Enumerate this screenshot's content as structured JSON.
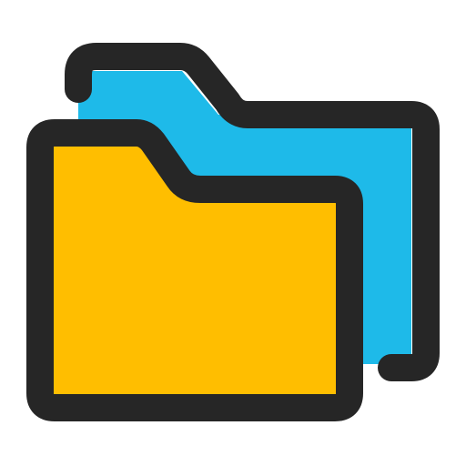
{
  "icon": {
    "name": "folders-icon",
    "colors": {
      "outline": "#262626",
      "back_folder_fill": "#1EBAE9",
      "front_folder_fill": "#FFBE00",
      "background": "#FFFFFF"
    }
  }
}
